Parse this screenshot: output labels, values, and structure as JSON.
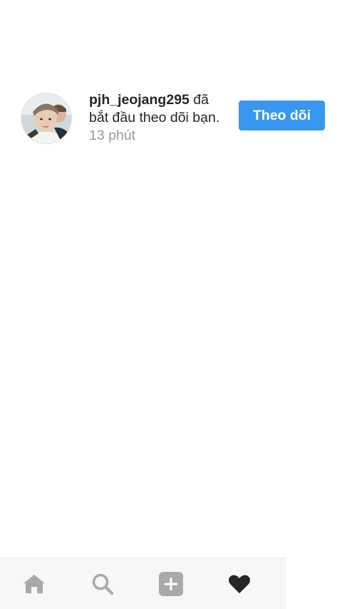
{
  "notification": {
    "username": "pjh_jeojang295",
    "message": " đã bắt đầu theo dõi bạn. ",
    "time": "13 phút",
    "follow_label": "Theo dõi",
    "follow_color": "#3897f0"
  },
  "bottom_nav": {
    "items": [
      {
        "icon": "home-icon",
        "active": false
      },
      {
        "icon": "search-icon",
        "active": false
      },
      {
        "icon": "add-post-icon",
        "active": false
      },
      {
        "icon": "heart-icon",
        "active": true
      }
    ]
  }
}
